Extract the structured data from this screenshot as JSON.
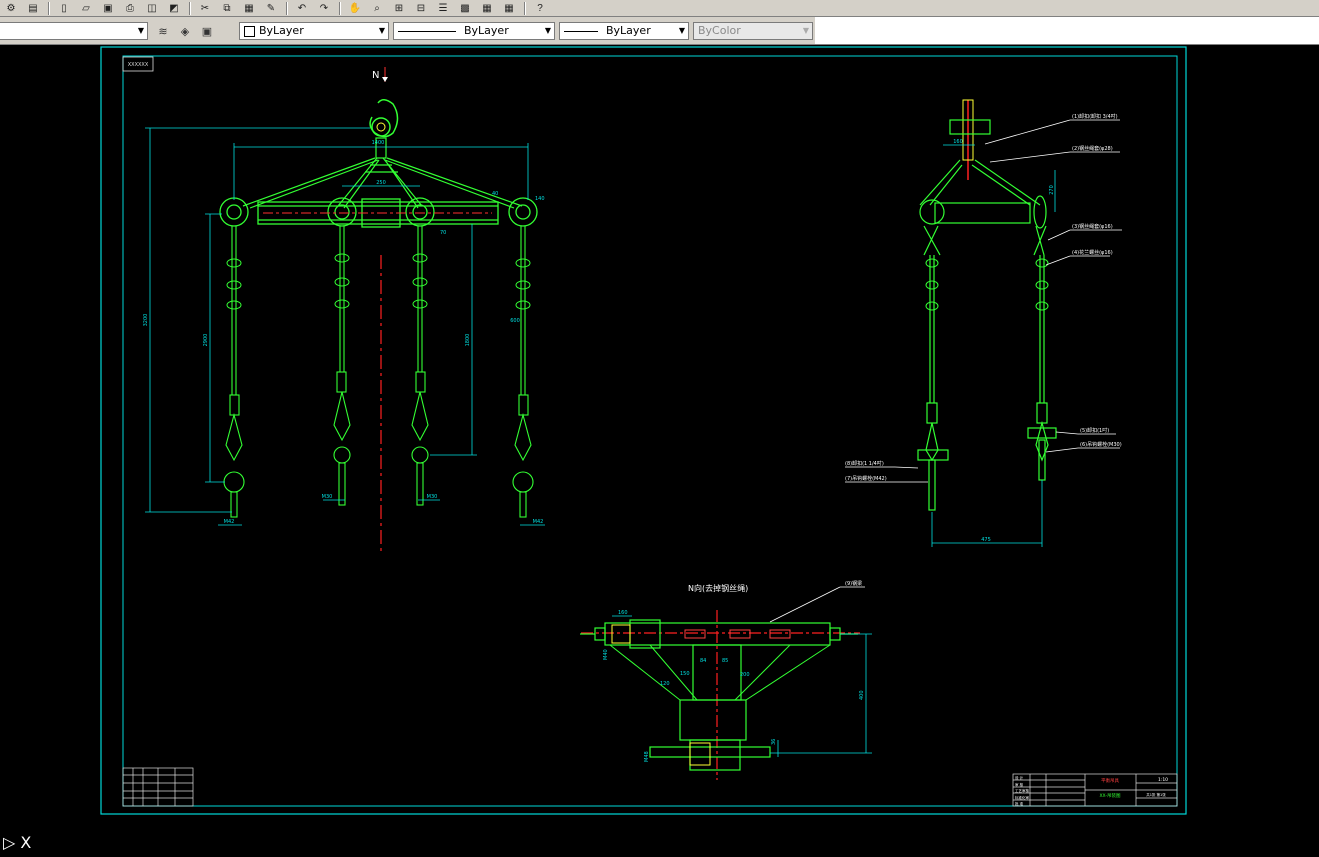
{
  "toolbar": {
    "icons": [
      "gear-icon",
      "printer-icon",
      "new-file-icon",
      "open-file-icon",
      "save-icon",
      "print-icon",
      "preview-icon",
      "publish-icon",
      "cut-icon",
      "copy-icon",
      "paste-icon",
      "match-properties-icon",
      "undo-icon",
      "redo-icon",
      "pan-icon",
      "zoom-realtime-icon",
      "zoom-window-icon",
      "zoom-previous-icon",
      "properties-icon",
      "design-center-icon",
      "tool-palette-icon",
      "calculator-icon",
      "help-icon"
    ]
  },
  "properties": {
    "color": "ByLayer",
    "linetype": "ByLayer",
    "lineweight": "ByLayer",
    "plotstyle": "ByColor"
  },
  "drawing": {
    "top_label": "N",
    "section_label": "N向(去掉钢丝绳)",
    "front": {
      "dim_1400": "1400",
      "dim_3200": "3200",
      "dim_2900": "2900",
      "dim_1800": "1800",
      "dim_250": "250",
      "dim_M42": "M42",
      "dim_M30": "M30",
      "dim_600": "600",
      "dim_40": "40",
      "dim_70": "70",
      "dim_140": "140"
    },
    "side": {
      "callouts": [
        "(1)卸扣(卸扣 3/4吋)",
        "(2)钢丝绳套(φ28)",
        "(3)钢丝绳套(φ16)",
        "(4)花兰螺丝(φ16)",
        "(5)卸扣(1吋)",
        "(6)吊钩螺栓(M30)",
        "(8)卸扣(1 1/4吋)",
        "(7)吊钩螺栓(M42)"
      ],
      "dim_475": "475",
      "dim_270": "270",
      "dim_160": "160"
    },
    "plan": {
      "callout": "(9)钢梁",
      "dims": [
        "160",
        "85",
        "84",
        "150",
        "200",
        "400",
        "120",
        "36",
        "M40",
        "M48"
      ]
    },
    "title_block": {
      "drawing_name": "平衡吊具",
      "drawing_no": "XX-吊装图",
      "scale": "1:10",
      "sheet": "共1张 第1张",
      "rows": [
        "设 计",
        "审 核",
        "工艺审核",
        "标准化审",
        "批 准"
      ]
    },
    "corner_stamp": "XXXXXX"
  }
}
